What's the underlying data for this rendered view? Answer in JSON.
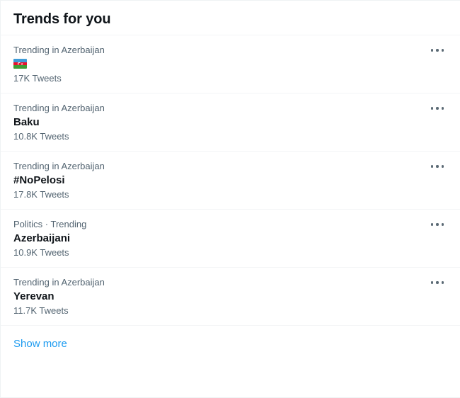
{
  "panel": {
    "title": "Trends for you",
    "accent_color": "#1d9bf0",
    "text_color": "#0f1419",
    "muted_color": "#536471",
    "background_color": "#ffffff",
    "separator_color": "#f3f5f6"
  },
  "trends": [
    {
      "category": "Trending in Azerbaijan",
      "name": "",
      "name_is_emoji": true,
      "emoji_name": "azerbaijan-flag-emoji",
      "count": "17K Tweets",
      "menu_icon": "more-horizontal-icon"
    },
    {
      "category": "Trending in Azerbaijan",
      "name": "Baku",
      "name_is_emoji": false,
      "emoji_name": "",
      "count": "10.8K Tweets",
      "menu_icon": "more-horizontal-icon"
    },
    {
      "category": "Trending in Azerbaijan",
      "name": "#NoPelosi",
      "name_is_emoji": false,
      "emoji_name": "",
      "count": "17.8K Tweets",
      "menu_icon": "more-horizontal-icon"
    },
    {
      "category": "Politics · Trending",
      "name": "Azerbaijani",
      "name_is_emoji": false,
      "emoji_name": "",
      "count": "10.9K Tweets",
      "menu_icon": "more-horizontal-icon"
    },
    {
      "category": "Trending in Azerbaijan",
      "name": "Yerevan",
      "name_is_emoji": false,
      "emoji_name": "",
      "count": "11.7K Tweets",
      "menu_icon": "more-horizontal-icon"
    }
  ],
  "footer": {
    "show_more_label": "Show more"
  }
}
